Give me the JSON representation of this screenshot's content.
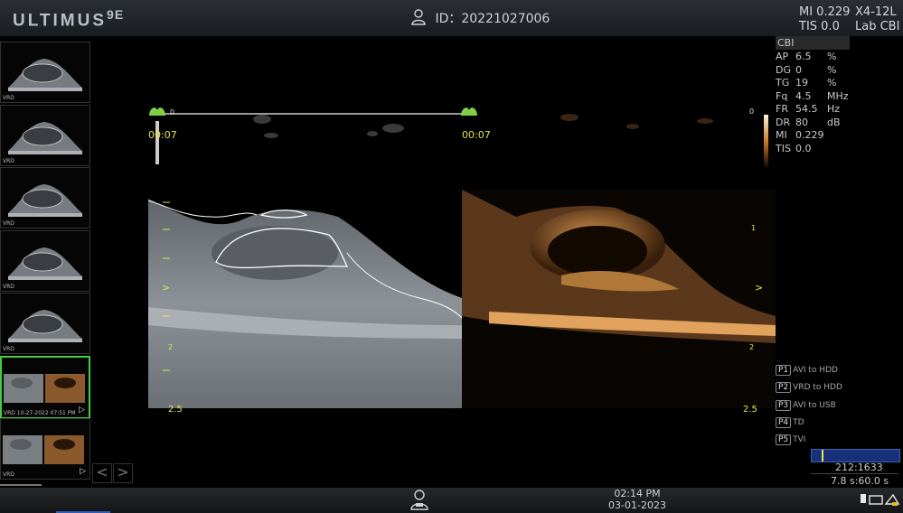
{
  "header": {
    "brand": "ULTIMUS",
    "brand_suffix": "9E",
    "patient_id": "ID：20221027006",
    "mi_label": "MI 0.229",
    "tis_label": "TIS 0.0",
    "probe": "X4-12L",
    "preset": "Lab CBI"
  },
  "thumbnails": [
    {
      "label": "VRD",
      "mode": "bmode"
    },
    {
      "label": "VRD",
      "mode": "bmode"
    },
    {
      "label": "VRD",
      "mode": "bmode"
    },
    {
      "label": "VRD",
      "mode": "bmode"
    },
    {
      "label": "VRD",
      "mode": "bmode"
    },
    {
      "label": "VRD 10-27-2022 07:51 PM",
      "mode": "dual",
      "selected": true,
      "play": "▷"
    },
    {
      "label": "VRD",
      "mode": "dual",
      "play": "▷"
    }
  ],
  "nav": {
    "prev": "<",
    "next": ">"
  },
  "image": {
    "tgc_left_time": "00:07",
    "tgc_right_time": "00:07",
    "depth_top": "0",
    "depth_bottom_left": "2.5",
    "depth_bottom_right": "2.5",
    "depth_mid_left": "2",
    "scale_top": "0",
    "scale_1": "1",
    "scale_2": "2",
    "focus_marker": ">"
  },
  "params": {
    "title": "CBI",
    "rows": [
      {
        "name": "AP",
        "value": "6.5",
        "unit": "%"
      },
      {
        "name": "DG",
        "value": "0",
        "unit": "%"
      },
      {
        "name": "TG",
        "value": "19",
        "unit": "%"
      },
      {
        "name": "Fq",
        "value": "4.5",
        "unit": "MHz"
      },
      {
        "name": "FR",
        "value": "54.5",
        "unit": "Hz"
      },
      {
        "name": "DR",
        "value": "80",
        "unit": "dB"
      },
      {
        "name": "MI",
        "value": "0.229",
        "unit": ""
      },
      {
        "name": "TIS",
        "value": "0.0",
        "unit": ""
      }
    ]
  },
  "presets": [
    {
      "key": "P1",
      "label": "AVI to HDD"
    },
    {
      "key": "P2",
      "label": "VRD to HDD"
    },
    {
      "key": "P3",
      "label": "AVI to USB"
    },
    {
      "key": "P4",
      "label": "TD"
    },
    {
      "key": "P5",
      "label": "TVI"
    }
  ],
  "cine": {
    "frames": "212:1633",
    "duration": "7.8 s:60.0 s",
    "position": 0.12
  },
  "footer": {
    "time": "02:14 PM",
    "date": "03-01-2023"
  },
  "colors": {
    "accent": "#3fcf3f",
    "depth_marks": "#e4e44a",
    "cine_bar": "#16317a"
  }
}
